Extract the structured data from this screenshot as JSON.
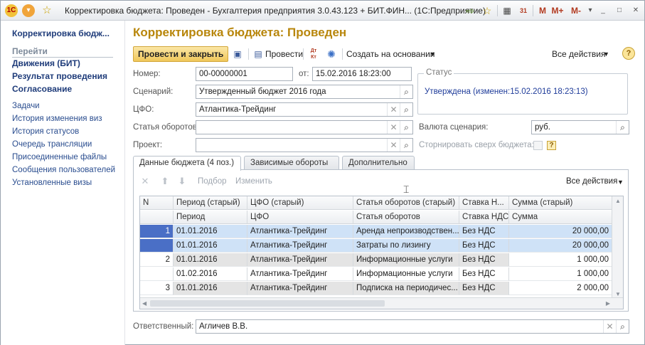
{
  "window": {
    "title": "Корректировка бюджета: Проведен - Бухгалтерия предприятия 3.0.43.123 + БИТ.ФИН...  (1С:Предприятие)",
    "logo": "1С",
    "toolbar_buttons": [
      "M",
      "M+",
      "M-"
    ],
    "icons": [
      "menu-icon",
      "star-icon",
      "back-icon",
      "favorites-icon",
      "calculator-icon",
      "calendar-icon",
      "minimize-icon",
      "restore-icon",
      "close-icon"
    ],
    "calendar_day": "31"
  },
  "sidebar": {
    "title": "Корректировка бюдж...",
    "section": "Перейти",
    "bold_links": [
      "Движения (БИТ)",
      "Результат проведения",
      "Согласование"
    ],
    "links": [
      "Задачи",
      "История изменения виз",
      "История статусов",
      "Очередь трансляции",
      "Присоединенные файлы",
      "Сообщения пользователей",
      "Установленные визы"
    ]
  },
  "document": {
    "title": "Корректировка бюджета: Проведен",
    "commands": {
      "post_and_close": "Провести и закрыть",
      "post": "Провести",
      "dt_kt": "Дт Кт",
      "create_based_on": "Создать на основании",
      "all_actions": "Все действия",
      "help": "?"
    },
    "fields": {
      "number_label": "Номер:",
      "number_value": "00-00000001",
      "date_label": "от:",
      "date_value": "15.02.2016 18:23:00",
      "scenario_label": "Сценарий:",
      "scenario_value": "Утвержденный бюджет 2016  года",
      "cfo_label": "ЦФО:",
      "cfo_value": "Атлантика-Трейдинг",
      "turnover_item_label": "Статья оборотов:",
      "turnover_item_value": "",
      "project_label": "Проект:",
      "project_value": "",
      "currency_label": "Валюта сценария:",
      "currency_value": "руб.",
      "reverse_label": "Сторнировать сверх бюджета:",
      "reverse_help": "?",
      "responsible_label": "Ответственный:",
      "responsible_value": "Агличев В.В."
    },
    "status": {
      "legend": "Статус",
      "value": "Утверждена (изменен:15.02.2016 18:23:13)"
    }
  },
  "tabs": [
    {
      "label": "Данные бюджета (4 поз.)",
      "active": true
    },
    {
      "label": "Зависимые обороты",
      "active": false
    },
    {
      "label": "Дополнительно",
      "active": false
    }
  ],
  "grid_toolbar": {
    "select_label": "Подбор",
    "edit_label": "Изменить",
    "all_actions": "Все действия"
  },
  "grid": {
    "headers_top": [
      "N",
      "Период (старый)",
      "ЦФО (старый)",
      "Статья оборотов (старый)",
      "Ставка Н...",
      "Сумма (старый)"
    ],
    "headers_bottom": [
      "",
      "Период",
      "ЦФО",
      "Статья оборотов",
      "Ставка НДС",
      "Сумма"
    ],
    "rows": [
      {
        "n": "1",
        "period": "01.01.2016",
        "cfo": "Атлантика-Трейдинг",
        "item": "Аренда непроизводствен...",
        "vat": "Без НДС",
        "sum": "20 000,00",
        "style": "sel-old"
      },
      {
        "n": "",
        "period": "01.01.2016",
        "cfo": "Атлантика-Трейдинг",
        "item": "Затраты по лизингу",
        "vat": "Без НДС",
        "sum": "20 000,00",
        "style": "sel-new"
      },
      {
        "n": "2",
        "period": "01.01.2016",
        "cfo": "Атлантика-Трейдинг",
        "item": "Информационные услуги",
        "vat": "Без НДС",
        "sum": "1 000,00",
        "style": "old"
      },
      {
        "n": "",
        "period": "01.02.2016",
        "cfo": "Атлантика-Трейдинг",
        "item": "Информационные услуги",
        "vat": "Без НДС",
        "sum": "1 000,00",
        "style": "new"
      },
      {
        "n": "3",
        "period": "01.01.2016",
        "cfo": "Атлантика-Трейдинг",
        "item": "Подписка на периодичес...",
        "vat": "Без НДС",
        "sum": "2 000,00",
        "style": "old"
      }
    ]
  },
  "colors": {
    "accent_title": "#b8860b",
    "selection": "#cfe2f7",
    "selection_n": "#4a6fc6",
    "old_row": "#e4e4e4"
  }
}
